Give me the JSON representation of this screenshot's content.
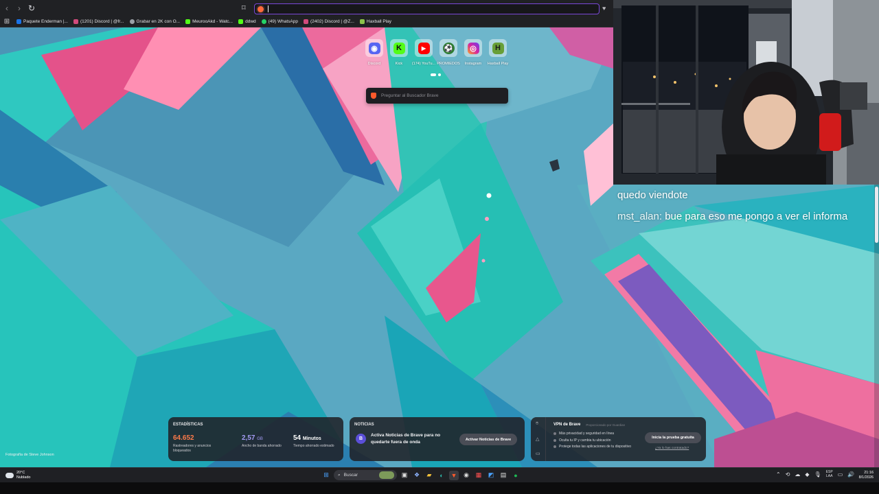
{
  "browser": {
    "address_value": "",
    "bookmarks": [
      {
        "label": "Paquete Enderman |...",
        "color": "#1a73e8"
      },
      {
        "label": "(1201) Discord | @fr...",
        "color": "#d14a7b"
      },
      {
        "label": "Grabar en 2K con O...",
        "color": "#9aa0a6"
      },
      {
        "label": "MeurooAkd - Watc...",
        "color": "#53fc18"
      },
      {
        "label": "ddwd",
        "color": "#53fc18"
      },
      {
        "label": "(49) WhatsApp",
        "color": "#25d366"
      },
      {
        "label": "(2402) Discord | @Z...",
        "color": "#d14a7b"
      },
      {
        "label": "Haxball Play",
        "color": "#8bc34a"
      }
    ]
  },
  "newtab": {
    "top_sites": [
      {
        "label": "Discord",
        "icon": "discord-icon",
        "color": "#5865f2",
        "glyph": "◉"
      },
      {
        "label": "Kick",
        "icon": "kick-icon",
        "color": "#53fc18",
        "glyph": "K"
      },
      {
        "label": "(174) YouTu...",
        "icon": "youtube-icon",
        "color": "#ff0000",
        "glyph": "▶"
      },
      {
        "label": "PROMIEDOS",
        "icon": "promiedos-icon",
        "color": "#2e7d32",
        "glyph": "⚽"
      },
      {
        "label": "Instagram",
        "icon": "instagram-icon",
        "color": "#d6249f",
        "glyph": "◎"
      },
      {
        "label": "Haxball Play",
        "icon": "haxball-icon",
        "color": "#689f38",
        "glyph": "H"
      }
    ],
    "search_placeholder": "Preguntar al Buscador Brave",
    "photo_credit": "Fotografía de Steve Johnson",
    "stats": {
      "title": "ESTADÍSTICAS",
      "trackers_value": "64.652",
      "trackers_desc": "Rastreadores y anuncios bloqueados",
      "bandwidth_value": "2,57",
      "bandwidth_unit": "GB",
      "bandwidth_desc": "Ancho de banda ahorrado",
      "time_value": "54",
      "time_unit": "Minutos",
      "time_desc": "Tiempo ahorrado estimado",
      "colors": {
        "trackers": "#fb7a4a",
        "bandwidth": "#a49cf4",
        "time": "#ffffff"
      }
    },
    "news": {
      "title": "NOTICIAS",
      "text": "Activa Noticias de Brave para no quedarte fuera de onda",
      "button": "Activar Noticias de Brave"
    },
    "vpn": {
      "title": "VPN de Brave",
      "subtitle": "Proporcionado por Guardian",
      "features": [
        "Más privacidad y seguridad en línea",
        "Oculta tu IP y cambia tu ubicación",
        "Protege todas las aplicaciones de tu dispositivo"
      ],
      "button": "Inicia la prueba gratuita",
      "link": "¿Ya lo has contratado?"
    }
  },
  "chat": {
    "line1": "quedo viendote",
    "line2_user": "mst_alan:",
    "line2_text": " bue para eso me pongo a ver el informa"
  },
  "taskbar": {
    "weather_temp": "20°C",
    "weather_desc": "Nublado",
    "search_label": "Buscar",
    "lang_top": "ESP",
    "lang_bottom": "LAA",
    "time": "21:16",
    "date": "8/1/2026"
  }
}
